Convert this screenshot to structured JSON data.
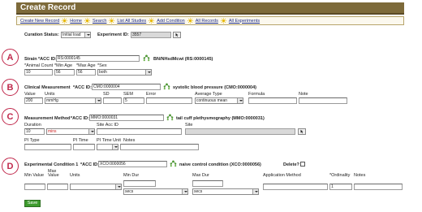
{
  "page": {
    "title": "Create Record"
  },
  "nav": [
    "Create New Record",
    "Home",
    "Search",
    "List All Studies",
    "Add Condition",
    "All Records",
    "All Experiments"
  ],
  "curation": {
    "status_label": "Curation Status:",
    "status_value": "Initial load",
    "experiment_label": "Experiment ID:",
    "experiment_value": "3557"
  },
  "markers": {
    "a": "A",
    "b": "B",
    "c": "C",
    "d": "D"
  },
  "strain": {
    "label": "Strain",
    "acc_label": "*ACC ID:",
    "acc_value": "RS:0000145",
    "name": "BN/NHsdMcwi (RS:0000145)",
    "animal_count_label": "*Animal Count",
    "min_age_label": "*Min Age",
    "max_age_label": "*Max Age",
    "sex_label": "*Sex",
    "animal_count": "10",
    "min_age": "56",
    "max_age": "56",
    "sex": "both"
  },
  "clinical": {
    "label": "Clinical Measurement",
    "acc_label": "*ACC ID:",
    "acc_value": "CMO:0000004",
    "name": "systolic blood pressure (CMO:0000004)",
    "value_label": "Value",
    "units_label": "Units",
    "sd_label": "SD",
    "sem_label": "SEM",
    "error_label": "Error",
    "avg_type_label": "Average Type",
    "formula_label": "Formula",
    "note_label": "Note",
    "value": "200",
    "units": "mmHg",
    "sem": "5",
    "avg_type": "continuous mean"
  },
  "method": {
    "label": "Measurement Method",
    "acc_label": "*ACC ID:",
    "acc_value": "MMO:0000031",
    "name": "tail cuff plethysmography (MMO:0000031)",
    "duration_label": "Duration",
    "site_acc_label": "Site Acc ID",
    "site_label": "Site",
    "duration_value": "10",
    "duration_units": "mins",
    "pi_type_label": "PI Type",
    "pi_time_label": "PI Time",
    "pi_time_unit_label": "PI Time Unit",
    "notes_label": "Notes"
  },
  "condition": {
    "label": "Experimental Condition 1",
    "acc_label": "*ACC ID:",
    "acc_value": "XCO:0000056",
    "name": "naive control condition (XCO:0000056)",
    "delete_label": "Delete?",
    "min_value_label": "Min Value",
    "max_value_label_1": "Max",
    "max_value_label_2": "Value",
    "units_label": "Units",
    "min_dur_label": "Min Dur",
    "max_dur_label": "Max Dur",
    "app_method_label": "Application Method",
    "ordinality_label": "*Ordinality",
    "notes_label": "Notes",
    "min_dur_units": "secs",
    "max_dur_units": "secs",
    "ordinality": "1"
  },
  "actions": {
    "save_label": "Save"
  },
  "colors": {
    "title_bar": "#7d6a3a",
    "nav_link": "#1a2a88",
    "marker": "#c0284b",
    "save_button": "#3e9c2e",
    "readonly_field": "#d9d9d9"
  }
}
